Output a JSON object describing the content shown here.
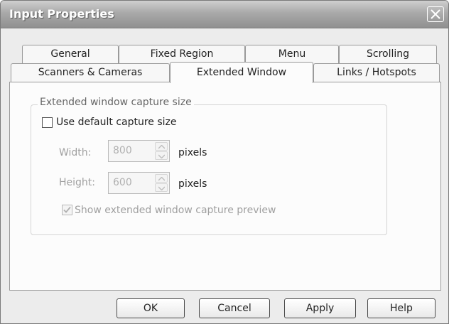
{
  "window": {
    "title": "Input Properties"
  },
  "tabs": {
    "row1": [
      "General",
      "Fixed Region",
      "Menu",
      "Scrolling"
    ],
    "row2": [
      "Scanners & Cameras",
      "Extended Window",
      "Links / Hotspots"
    ],
    "active": "Extended Window"
  },
  "group": {
    "legend": "Extended window capture size",
    "use_default_label": "Use default capture size",
    "use_default_checked": false,
    "width_label": "Width:",
    "width_value": "800",
    "height_label": "Height:",
    "height_value": "600",
    "units": "pixels",
    "preview_label": "Show extended window capture preview",
    "preview_checked": true
  },
  "buttons": {
    "ok": "OK",
    "cancel": "Cancel",
    "apply": "Apply",
    "help": "Help"
  },
  "icons": {
    "close": "close-icon",
    "spin_up": "spin-up-icon",
    "spin_down": "spin-down-icon",
    "check": "checkmark-icon"
  }
}
